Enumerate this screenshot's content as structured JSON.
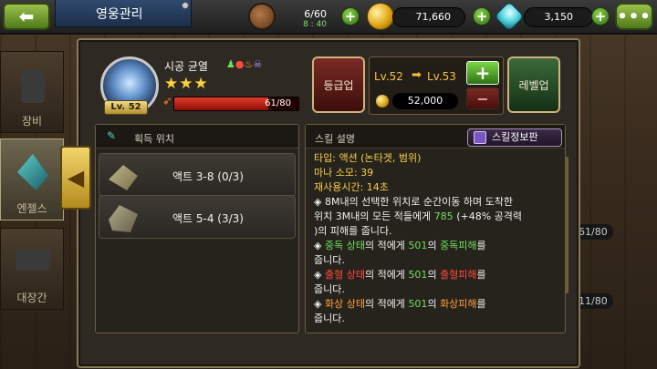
{
  "header": {
    "title": "영웅관리",
    "stamina": "6/60",
    "stamina_timer": "8 : 40",
    "gold": "71,660",
    "gems": "3,150",
    "back_symbol": "⬅",
    "menu_symbol": "•••"
  },
  "sidebar": {
    "items": [
      {
        "label": "장비"
      },
      {
        "label": "엔젤스"
      },
      {
        "label": "대장간"
      }
    ]
  },
  "hero": {
    "name": "시공 균열",
    "level": "Lv. 52",
    "stars": "★★★",
    "exp": "61/80",
    "exp_fraction": 0.76
  },
  "buttons": {
    "grade_up": "등급업",
    "level_up": "레벨업"
  },
  "level_panel": {
    "from": "Lv.52",
    "to": "Lv.53",
    "cost": "52,000",
    "plus": "+",
    "minus": "−"
  },
  "acquire": {
    "title": "획득 위치",
    "rows": [
      {
        "label": "액트 3-8 (0/3)"
      },
      {
        "label": "액트 5-4 (3/3)"
      }
    ]
  },
  "skill": {
    "title": "스킬 설명",
    "card_button": "스킬정보판",
    "type": "타입: 액션 (논타겟, 범위)",
    "mana": "마나 소모: 39",
    "cooldown": "재사용시간: 14초",
    "desc1_a": "◈ 8M내의 선택한 위치로 순간이동 하며 도착한",
    "desc1_b": "위치 3M내의 모든 적들에게",
    "desc1_val": "785",
    "desc1_pct": "(+48% 공격력",
    "desc1_c": ")의 피해를 줍니다.",
    "poison_a": "◈",
    "poison_state": "중독 상태",
    "poison_b": "의 적에게",
    "poison_val": "501",
    "poison_dmg": "의",
    "poison_name": "중독피해",
    "poison_c": "를",
    "poison_d": "줍니다.",
    "bleed_a": "◈",
    "bleed_state": "출혈 상태",
    "bleed_b": "의 적에게",
    "bleed_val": "501",
    "bleed_dmg": "의",
    "bleed_name": "출혈피해",
    "bleed_c": "를",
    "bleed_d": "줍니다.",
    "burn_a": "◈",
    "burn_state": "화상 상태",
    "burn_b": "의 적에게",
    "burn_val": "501",
    "burn_dmg": "의",
    "burn_name": "화상피해",
    "burn_c": "를",
    "burn_d": "줍니다."
  },
  "background": {
    "right_label_1": "61/80",
    "right_label_2": "11/80"
  },
  "colors": {
    "accent_gold": "#f7d14a",
    "poison": "#6fe05e",
    "bleed": "#ff4b3b",
    "burn": "#ffa03a",
    "exp_bar": "#e43a2a"
  }
}
